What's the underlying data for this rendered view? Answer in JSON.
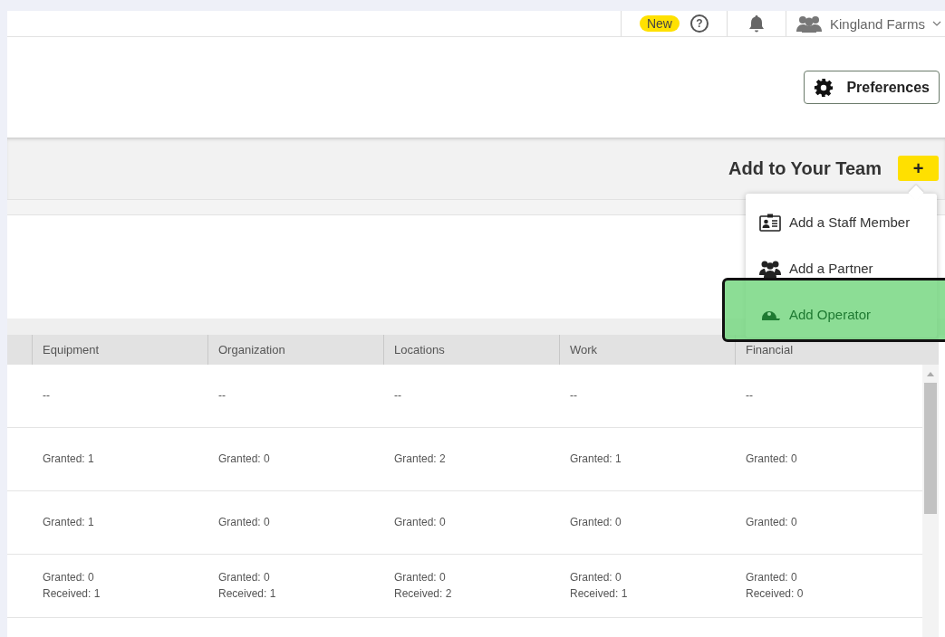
{
  "top_bar": {
    "new_badge": "New",
    "help_glyph": "?",
    "account": "Kingland Farms"
  },
  "preferences_button": "Preferences",
  "team_bar": {
    "title": "Add to Your Team",
    "add_glyph": "+"
  },
  "add_menu": [
    {
      "kind": "staff",
      "label": "Add a Staff Member",
      "highlighted": false
    },
    {
      "kind": "partner",
      "label": "Add a Partner",
      "highlighted": false
    },
    {
      "kind": "operator",
      "label": "Add Operator",
      "highlighted": true
    }
  ],
  "table": {
    "columns": [
      "Equipment",
      "Organization",
      "Locations",
      "Work",
      "Financial"
    ],
    "rows": [
      [
        "--",
        "--",
        "--",
        "--",
        "--"
      ],
      [
        "Granted: 1",
        "Granted: 0",
        "Granted: 2",
        "Granted: 1",
        "Granted: 0"
      ],
      [
        "Granted: 1",
        "Granted: 0",
        "Granted: 0",
        "Granted: 0",
        "Granted: 0"
      ],
      [
        "Granted: 0\nReceived: 1",
        "Granted: 0\nReceived: 1",
        "Granted: 0\nReceived: 2",
        "Granted: 0\nReceived: 1",
        "Granted: 0\nReceived: 0"
      ]
    ]
  }
}
